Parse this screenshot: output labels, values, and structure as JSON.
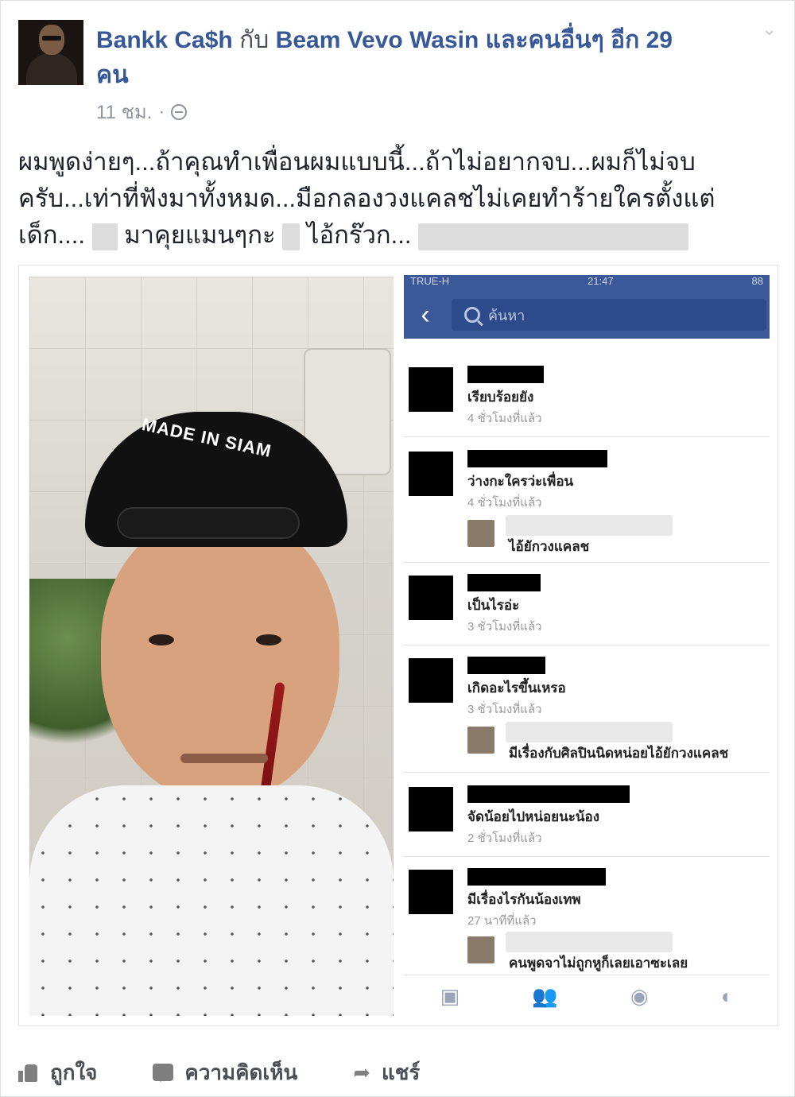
{
  "header": {
    "author": "Bankk Ca$h",
    "connector": "กับ",
    "tagged": "Beam Vevo Wasin",
    "others_text": "และคนอื่นๆ อีก 29 คน",
    "time": "11 ชม.",
    "separator": "·"
  },
  "post": {
    "line1": "ผมพูดง่ายๆ...ถ้าคุณทำเพื่อนผมแบบนี้...ถ้าไม่อยากจบ...ผมก็ไม่จบ",
    "line2": "ครับ...เท่าที่ฟังมาทั้งหมด...มือกลองวงแคลชไม่เคยทำร้ายใครตั้งแต่",
    "line3_a": "เด็ก....",
    "line3_b": "มาคุยแมนๆกะ",
    "line3_c": "ไอ้กร๊วก..."
  },
  "image": {
    "cap_text": "MADE IN SIAM",
    "phone": {
      "carrier": "TRUE-H",
      "clock": "21:47",
      "battery": "88",
      "back_glyph": "‹",
      "search_placeholder": "ค้นหา",
      "threads": [
        {
          "message": "เรียบร้อยยัง",
          "time": "4 ชั่วโมงที่แล้ว"
        },
        {
          "message": "ว่างกะใครว่ะเพื่อน",
          "time": "4 ชั่วโมงที่แล้ว",
          "reply": "ไอ้ยักวงแคลช"
        },
        {
          "message": "เป็นไรอ่ะ",
          "time": "3 ชั่วโมงที่แล้ว"
        },
        {
          "message": "เกิดอะไรขึ้นเหรอ",
          "time": "3 ชั่วโมงที่แล้ว",
          "reply": "มีเรื่องกับศิลปินนิดหน่อยไอ้ยักวงแคลช"
        },
        {
          "message": "จัดน้อยไปหน่อยนะน้อง",
          "time": "2 ชั่วโมงที่แล้ว"
        },
        {
          "message": "มีเรื่องไรกันน้องเทพ",
          "time": "27 นาทีที่แล้ว",
          "reply": "คนพูดจาไม่ถูกหูก็เลยเอาซะเลย"
        }
      ],
      "tab_icons": [
        "feed-icon",
        "friends-icon",
        "messenger-icon",
        "globe-icon"
      ]
    }
  },
  "actions": {
    "like": "ถูกใจ",
    "comment": "ความคิดเห็น",
    "share": "แชร์"
  },
  "colors": {
    "link": "#365899",
    "facebook_blue": "#3b5998",
    "muted": "#90949c"
  }
}
